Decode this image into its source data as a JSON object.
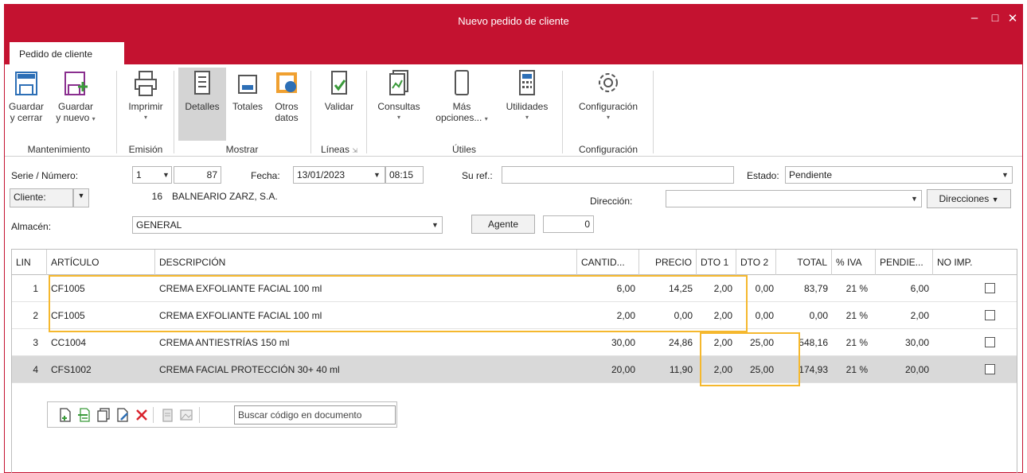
{
  "window": {
    "title": "Nuevo pedido de cliente",
    "tab": "Pedido de cliente",
    "buttons": {
      "minimize": "–",
      "maximize": "□",
      "close": "✕"
    }
  },
  "ribbon": {
    "guardar_cerrar": [
      "Guardar",
      "y cerrar"
    ],
    "guardar_nuevo": [
      "Guardar",
      "y nuevo"
    ],
    "imprimir": "Imprimir",
    "detalles": "Detalles",
    "totales": "Totales",
    "otros_datos": [
      "Otros",
      "datos"
    ],
    "validar": "Validar",
    "consultas": "Consultas",
    "mas_opciones": [
      "Más",
      "opciones..."
    ],
    "utilidades": "Utilidades",
    "configuracion": "Configuración",
    "groups": {
      "mantenimiento": "Mantenimiento",
      "emision": "Emisión",
      "mostrar": "Mostrar",
      "lineas": "Líneas",
      "utiles": "Útiles",
      "configuracion": "Configuración"
    }
  },
  "form": {
    "serie_label": "Serie / Número:",
    "serie_value": "1",
    "numero_value": "87",
    "fecha_label": "Fecha:",
    "fecha_value": "13/01/2023",
    "hora_value": "08:15",
    "suref_label": "Su ref.:",
    "suref_value": "",
    "estado_label": "Estado:",
    "estado_value": "Pendiente",
    "cliente_label": "Cliente:",
    "cliente_code": "16",
    "cliente_name": "BALNEARIO ZARZ, S.A.",
    "direccion_label": "Dirección:",
    "direccion_value": "",
    "direcciones_button": "Direcciones",
    "almacen_label": "Almacén:",
    "almacen_value": "GENERAL",
    "agente_button": "Agente",
    "agente_value": "0"
  },
  "grid": {
    "headers": {
      "lin": "LIN",
      "articulo": "ARTÍCULO",
      "descripcion": "DESCRIPCIÓN",
      "cantidad": "CANTID...",
      "precio": "PRECIO",
      "dto1": "DTO 1",
      "dto2": "DTO 2",
      "total": "TOTAL",
      "iva": "% IVA",
      "pendiente": "PENDIE...",
      "noimp": "NO IMP."
    },
    "rows": [
      {
        "lin": "1",
        "articulo": "CF1005",
        "descripcion": "CREMA EXFOLIANTE FACIAL 100 ml",
        "cantidad": "6,00",
        "precio": "14,25",
        "dto1": "2,00",
        "dto2": "0,00",
        "total": "83,79",
        "iva": "21 %",
        "pendiente": "6,00",
        "noimp": false
      },
      {
        "lin": "2",
        "articulo": "CF1005",
        "descripcion": "CREMA EXFOLIANTE FACIAL 100 ml",
        "cantidad": "2,00",
        "precio": "0,00",
        "dto1": "2,00",
        "dto2": "0,00",
        "total": "0,00",
        "iva": "21 %",
        "pendiente": "2,00",
        "noimp": false
      },
      {
        "lin": "3",
        "articulo": "CC1004",
        "descripcion": "CREMA ANTIESTRÍAS 150 ml",
        "cantidad": "30,00",
        "precio": "24,86",
        "dto1": "2,00",
        "dto2": "25,00",
        "total": "548,16",
        "iva": "21 %",
        "pendiente": "30,00",
        "noimp": false
      },
      {
        "lin": "4",
        "articulo": "CFS1002",
        "descripcion": "CREMA FACIAL PROTECCIÓN 30+ 40 ml",
        "cantidad": "20,00",
        "precio": "11,90",
        "dto1": "2,00",
        "dto2": "25,00",
        "total": "174,93",
        "iva": "21 %",
        "pendiente": "20,00",
        "noimp": false
      }
    ],
    "search_placeholder": "Buscar código en documento"
  },
  "colors": {
    "brand": "#c41230",
    "highlight": "#f5b82e",
    "selected_row": "#d9d9d9"
  }
}
